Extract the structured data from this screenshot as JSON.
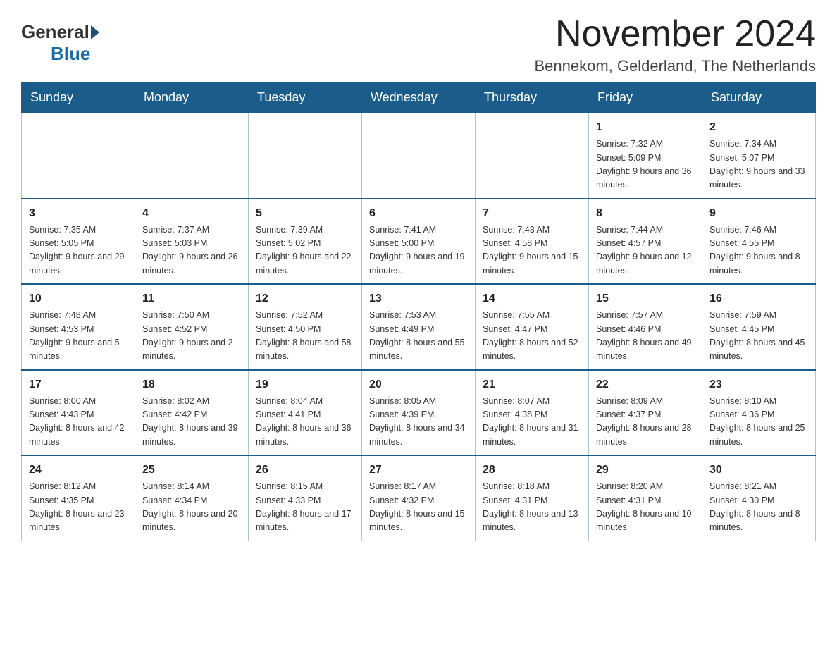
{
  "logo": {
    "general": "General",
    "blue": "Blue"
  },
  "title": {
    "month_year": "November 2024",
    "location": "Bennekom, Gelderland, The Netherlands"
  },
  "days_of_week": [
    "Sunday",
    "Monday",
    "Tuesday",
    "Wednesday",
    "Thursday",
    "Friday",
    "Saturday"
  ],
  "weeks": [
    [
      {
        "day": "",
        "info": ""
      },
      {
        "day": "",
        "info": ""
      },
      {
        "day": "",
        "info": ""
      },
      {
        "day": "",
        "info": ""
      },
      {
        "day": "",
        "info": ""
      },
      {
        "day": "1",
        "info": "Sunrise: 7:32 AM\nSunset: 5:09 PM\nDaylight: 9 hours and 36 minutes."
      },
      {
        "day": "2",
        "info": "Sunrise: 7:34 AM\nSunset: 5:07 PM\nDaylight: 9 hours and 33 minutes."
      }
    ],
    [
      {
        "day": "3",
        "info": "Sunrise: 7:35 AM\nSunset: 5:05 PM\nDaylight: 9 hours and 29 minutes."
      },
      {
        "day": "4",
        "info": "Sunrise: 7:37 AM\nSunset: 5:03 PM\nDaylight: 9 hours and 26 minutes."
      },
      {
        "day": "5",
        "info": "Sunrise: 7:39 AM\nSunset: 5:02 PM\nDaylight: 9 hours and 22 minutes."
      },
      {
        "day": "6",
        "info": "Sunrise: 7:41 AM\nSunset: 5:00 PM\nDaylight: 9 hours and 19 minutes."
      },
      {
        "day": "7",
        "info": "Sunrise: 7:43 AM\nSunset: 4:58 PM\nDaylight: 9 hours and 15 minutes."
      },
      {
        "day": "8",
        "info": "Sunrise: 7:44 AM\nSunset: 4:57 PM\nDaylight: 9 hours and 12 minutes."
      },
      {
        "day": "9",
        "info": "Sunrise: 7:46 AM\nSunset: 4:55 PM\nDaylight: 9 hours and 8 minutes."
      }
    ],
    [
      {
        "day": "10",
        "info": "Sunrise: 7:48 AM\nSunset: 4:53 PM\nDaylight: 9 hours and 5 minutes."
      },
      {
        "day": "11",
        "info": "Sunrise: 7:50 AM\nSunset: 4:52 PM\nDaylight: 9 hours and 2 minutes."
      },
      {
        "day": "12",
        "info": "Sunrise: 7:52 AM\nSunset: 4:50 PM\nDaylight: 8 hours and 58 minutes."
      },
      {
        "day": "13",
        "info": "Sunrise: 7:53 AM\nSunset: 4:49 PM\nDaylight: 8 hours and 55 minutes."
      },
      {
        "day": "14",
        "info": "Sunrise: 7:55 AM\nSunset: 4:47 PM\nDaylight: 8 hours and 52 minutes."
      },
      {
        "day": "15",
        "info": "Sunrise: 7:57 AM\nSunset: 4:46 PM\nDaylight: 8 hours and 49 minutes."
      },
      {
        "day": "16",
        "info": "Sunrise: 7:59 AM\nSunset: 4:45 PM\nDaylight: 8 hours and 45 minutes."
      }
    ],
    [
      {
        "day": "17",
        "info": "Sunrise: 8:00 AM\nSunset: 4:43 PM\nDaylight: 8 hours and 42 minutes."
      },
      {
        "day": "18",
        "info": "Sunrise: 8:02 AM\nSunset: 4:42 PM\nDaylight: 8 hours and 39 minutes."
      },
      {
        "day": "19",
        "info": "Sunrise: 8:04 AM\nSunset: 4:41 PM\nDaylight: 8 hours and 36 minutes."
      },
      {
        "day": "20",
        "info": "Sunrise: 8:05 AM\nSunset: 4:39 PM\nDaylight: 8 hours and 34 minutes."
      },
      {
        "day": "21",
        "info": "Sunrise: 8:07 AM\nSunset: 4:38 PM\nDaylight: 8 hours and 31 minutes."
      },
      {
        "day": "22",
        "info": "Sunrise: 8:09 AM\nSunset: 4:37 PM\nDaylight: 8 hours and 28 minutes."
      },
      {
        "day": "23",
        "info": "Sunrise: 8:10 AM\nSunset: 4:36 PM\nDaylight: 8 hours and 25 minutes."
      }
    ],
    [
      {
        "day": "24",
        "info": "Sunrise: 8:12 AM\nSunset: 4:35 PM\nDaylight: 8 hours and 23 minutes."
      },
      {
        "day": "25",
        "info": "Sunrise: 8:14 AM\nSunset: 4:34 PM\nDaylight: 8 hours and 20 minutes."
      },
      {
        "day": "26",
        "info": "Sunrise: 8:15 AM\nSunset: 4:33 PM\nDaylight: 8 hours and 17 minutes."
      },
      {
        "day": "27",
        "info": "Sunrise: 8:17 AM\nSunset: 4:32 PM\nDaylight: 8 hours and 15 minutes."
      },
      {
        "day": "28",
        "info": "Sunrise: 8:18 AM\nSunset: 4:31 PM\nDaylight: 8 hours and 13 minutes."
      },
      {
        "day": "29",
        "info": "Sunrise: 8:20 AM\nSunset: 4:31 PM\nDaylight: 8 hours and 10 minutes."
      },
      {
        "day": "30",
        "info": "Sunrise: 8:21 AM\nSunset: 4:30 PM\nDaylight: 8 hours and 8 minutes."
      }
    ]
  ]
}
